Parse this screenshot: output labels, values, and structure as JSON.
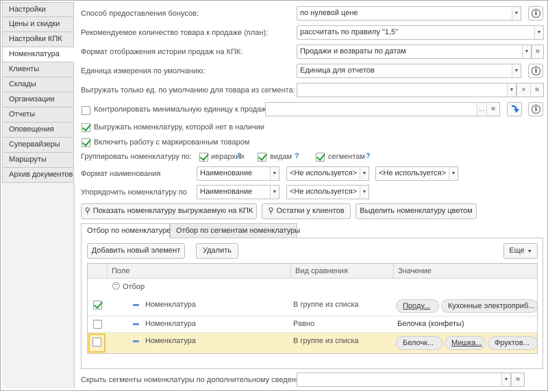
{
  "sidebar": {
    "items": [
      {
        "label": "Настройки",
        "active": false
      },
      {
        "label": "Цены и скидки",
        "active": false
      },
      {
        "label": "Настройки КПК",
        "active": false
      },
      {
        "label": "Номенклатура",
        "active": true
      },
      {
        "label": "Клиенты",
        "active": false
      },
      {
        "label": "Склады",
        "active": false
      },
      {
        "label": "Организации",
        "active": false
      },
      {
        "label": "Отчеты",
        "active": false
      },
      {
        "label": "Оповещения",
        "active": false
      },
      {
        "label": "Супервайзеры",
        "active": false
      },
      {
        "label": "Маршруты",
        "active": false
      },
      {
        "label": "Архив документов",
        "active": false
      }
    ]
  },
  "form": {
    "bonus_method": {
      "label": "Способ предоставления бонусов:",
      "value": "по нулевой цене"
    },
    "recommended_qty": {
      "label": "Рекомендуемое количество товара к продаже (план):",
      "value": "рассчитать по правилу \"1,5\""
    },
    "history_format": {
      "label": "Формат отображения истории продаж на КПК:",
      "value": "Продажи и возвраты по датам"
    },
    "default_unit": {
      "label": "Единица измерения по умолчанию:",
      "value": "Единица для отчетов"
    },
    "export_default_unit": {
      "label": "Выгружать только ед. по умолчанию для товара из сегмента:",
      "value": ""
    },
    "control_min_unit": {
      "label": "Контролировать минимальную единицу к продаже",
      "checked": false,
      "value": ""
    },
    "export_missing": {
      "label": "Выгружать номенклатуру, которой нет в наличии",
      "checked": true
    },
    "marked_goods": {
      "label": "Включить работу с маркированным товаром",
      "checked": true
    },
    "group_by": {
      "label": "Группировать номенклатуру по:",
      "options": [
        {
          "label": "иерархии",
          "checked": true
        },
        {
          "label": "видам",
          "checked": true
        },
        {
          "label": "сегментам",
          "checked": true
        }
      ],
      "help": "?"
    },
    "name_format": {
      "label": "Формат наименования",
      "values": [
        "Наименование",
        "<Не используется>",
        "<Не используется>"
      ]
    },
    "sort_by": {
      "label": "Упорядочить номенклатуру по",
      "values": [
        "Наименование",
        "<Не используется>"
      ]
    }
  },
  "actions": {
    "show_exported": "Показать номенклатуру выгружаемую на КПК",
    "client_stock": "Остатки у клиентов",
    "highlight_color": "Выделить номенклатуру цветом"
  },
  "tabs": [
    {
      "label": "Отбор по номенклатуре",
      "active": true
    },
    {
      "label": "Отбор по сегментам номенклатуры",
      "active": false
    }
  ],
  "filter": {
    "add_button": "Добавить новый элемент",
    "delete_button": "Удалить",
    "more_button": "Еще",
    "columns": [
      "Поле",
      "Вид сравнения",
      "Значение"
    ],
    "group_label": "Отбор",
    "rows": [
      {
        "checked": true,
        "field": "Номенклатура",
        "comparison": "В группе из списка",
        "values": [
          "Проду...",
          "Кухонные электроприб..."
        ]
      },
      {
        "checked": false,
        "field": "Номенклатура",
        "comparison": "Равно",
        "value_text": "Белочка (конфеты)"
      },
      {
        "checked": false,
        "field": "Номенклатура",
        "comparison": "В группе из списка",
        "values": [
          "Белочк...",
          "Мишка...",
          "Фруктов..."
        ]
      }
    ]
  },
  "hide_segments": {
    "label": "Скрыть сегменты номенклатуры по дополнительному сведению:",
    "value": ""
  },
  "colors": {
    "accent_check": "#1e9e2d",
    "help_blue": "#2b7bd6",
    "selected_row": "#fbf1c7",
    "selection_border": "#f5c542"
  }
}
